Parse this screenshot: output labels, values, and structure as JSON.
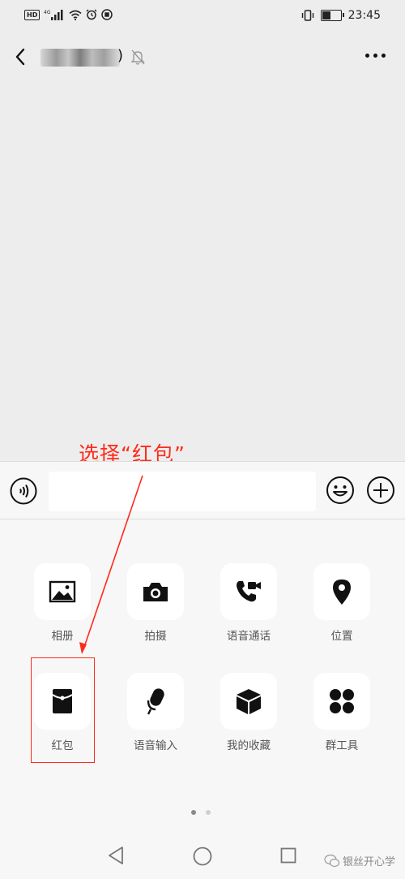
{
  "status_bar": {
    "hd_badge": "HD",
    "network": "4G",
    "time": "23:45",
    "battery_level": 0.45,
    "icons": [
      "hd-icon",
      "signal-icon",
      "wifi-icon",
      "alarm-icon",
      "app-icon",
      "vibrate-icon",
      "battery-icon"
    ]
  },
  "chat_header": {
    "title_visible_suffix": ")",
    "icons": [
      "back-icon",
      "mute-icon",
      "more-icon"
    ]
  },
  "annotation": {
    "text": "选择“红包”",
    "color": "#ff2a1a"
  },
  "input_bar": {
    "value": "",
    "icons": [
      "voice-icon",
      "emoji-icon",
      "plus-icon"
    ]
  },
  "actions": [
    {
      "label": "相册",
      "icon": "photo-album-icon"
    },
    {
      "label": "拍摄",
      "icon": "camera-icon"
    },
    {
      "label": "语音通话",
      "icon": "voice-video-call-icon"
    },
    {
      "label": "位置",
      "icon": "location-pin-icon"
    },
    {
      "label": "红包",
      "icon": "red-packet-icon"
    },
    {
      "label": "语音输入",
      "icon": "microphone-icon"
    },
    {
      "label": "我的收藏",
      "icon": "favorites-box-icon"
    },
    {
      "label": "群工具",
      "icon": "group-tools-icon"
    }
  ],
  "pager": {
    "pages": 2,
    "current": 1
  },
  "nav_bar": {
    "icons": [
      "nav-back-icon",
      "nav-home-icon",
      "nav-recent-icon"
    ]
  },
  "watermark": {
    "text": "银丝开心学"
  }
}
